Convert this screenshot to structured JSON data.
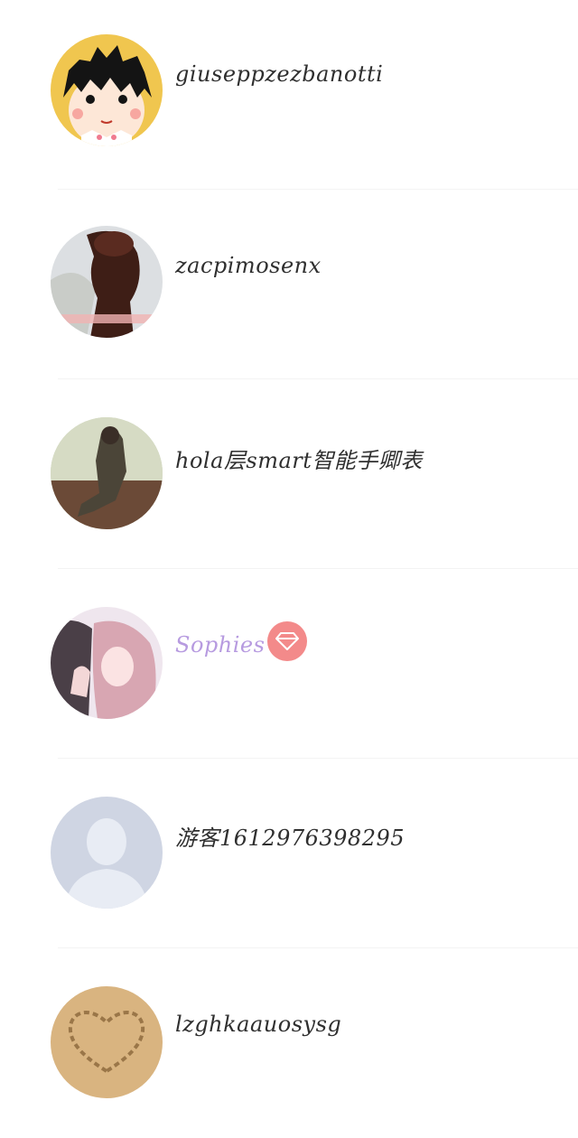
{
  "users": [
    {
      "name": "giuseppzezbanotti",
      "avatar": "cartoon-girl-avatar"
    },
    {
      "name": "zacpimosenx",
      "avatar": "illustration-avatar"
    },
    {
      "name": "hola层smart智能手卿表",
      "avatar": "photo-avatar"
    },
    {
      "name": "Sophies",
      "avatar": "anime-couple-avatar",
      "vip": true,
      "badge_icon": "diamond-icon",
      "badge_color": "#f38a8a",
      "name_color": "#b79be0"
    },
    {
      "name": "游客1612976398295",
      "avatar": "default-avatar"
    },
    {
      "name": "lzghkaauosysg",
      "avatar": "sand-heart-avatar"
    }
  ]
}
